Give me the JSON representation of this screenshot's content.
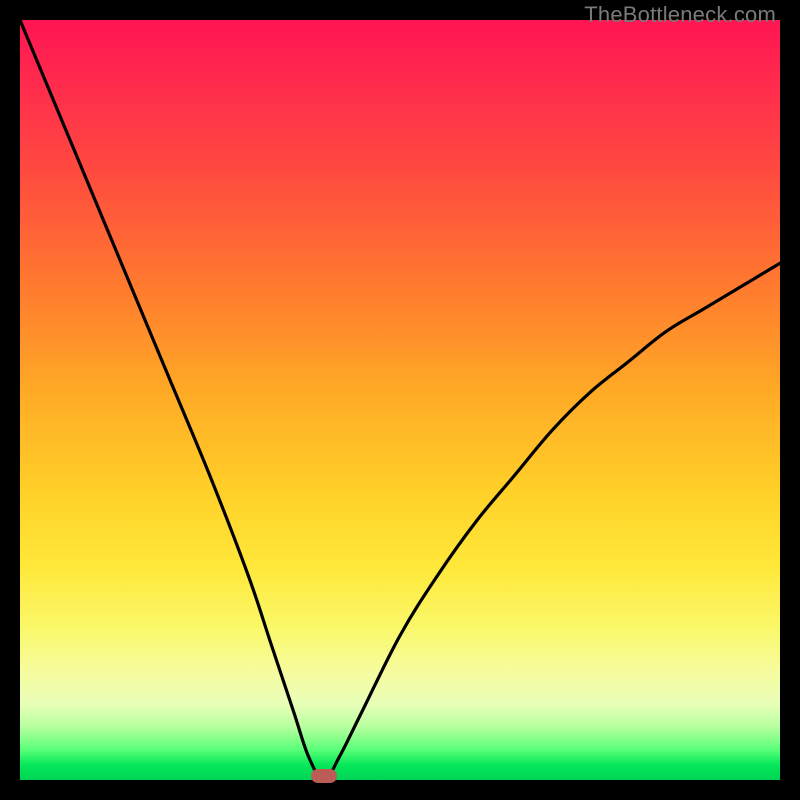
{
  "watermark": "TheBottleneck.com",
  "colors": {
    "frame": "#000000",
    "curve": "#000000",
    "marker": "#bb5c56"
  },
  "chart_data": {
    "type": "line",
    "title": "",
    "xlabel": "",
    "ylabel": "",
    "xlim": [
      0,
      100
    ],
    "ylim": [
      0,
      100
    ],
    "grid": false,
    "notes": "V-shaped bottleneck curve; minimum at the marker; axes have no visible tick labels",
    "marker": {
      "x": 40,
      "y": 0
    },
    "series": [
      {
        "name": "bottleneck-curve",
        "x": [
          0,
          5,
          10,
          15,
          20,
          25,
          30,
          33,
          36,
          38,
          40,
          42,
          45,
          50,
          55,
          60,
          65,
          70,
          75,
          80,
          85,
          90,
          95,
          100
        ],
        "y": [
          100,
          88,
          76,
          64,
          52,
          40,
          27,
          18,
          9,
          3,
          0,
          3,
          9,
          19,
          27,
          34,
          40,
          46,
          51,
          55,
          59,
          62,
          65,
          68
        ]
      }
    ]
  }
}
